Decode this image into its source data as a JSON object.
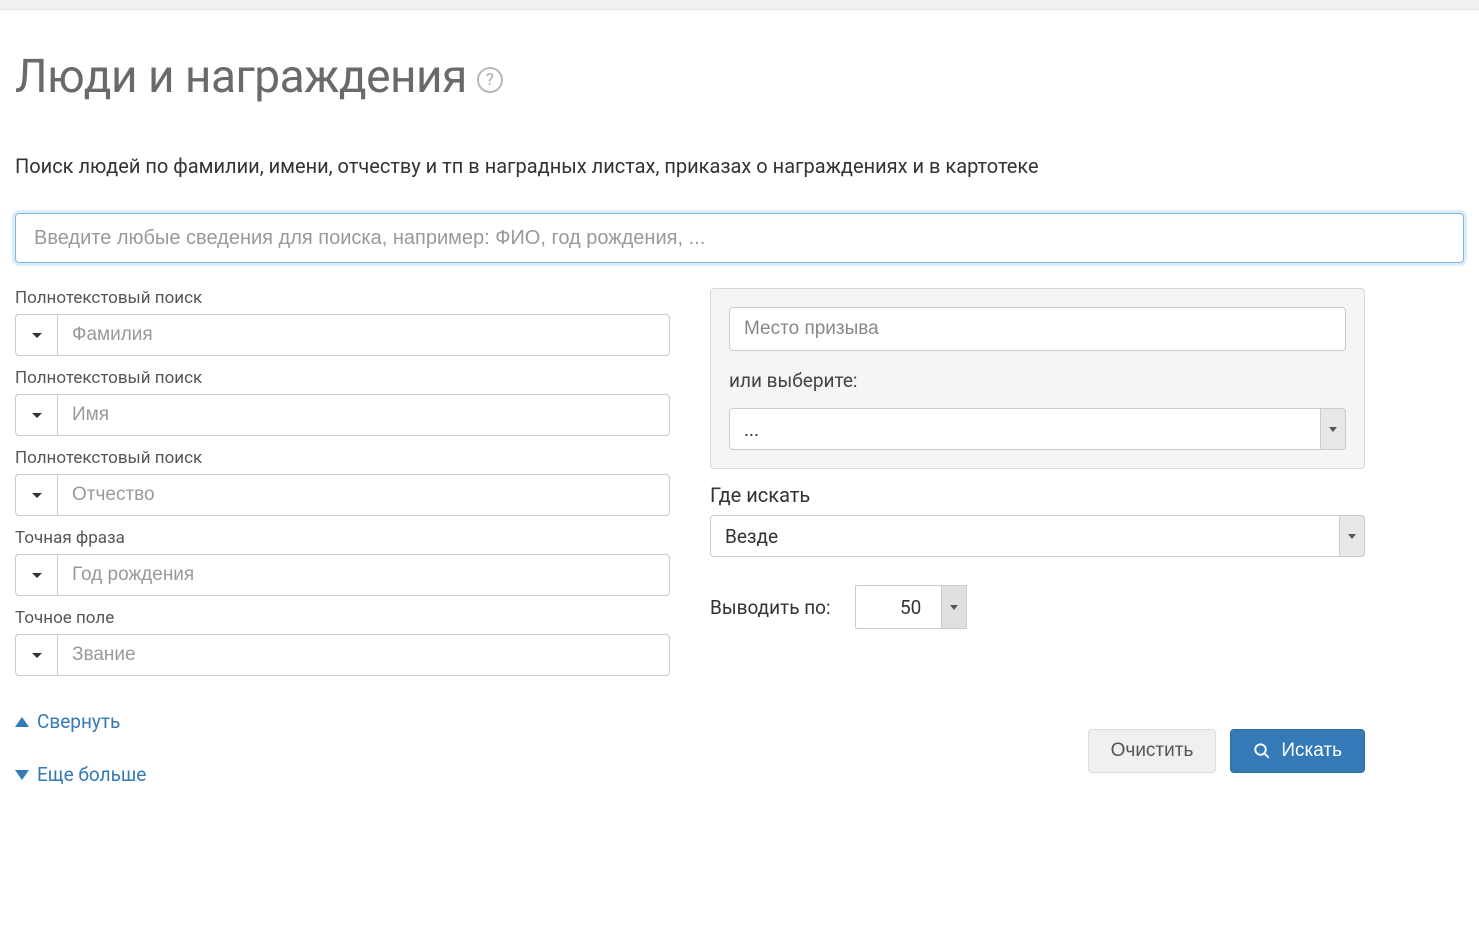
{
  "page": {
    "title": "Люди и награждения",
    "description": "Поиск людей по фамилии, имени, отчеству и тп в наградных листах, приказах о награждениях и в картотеке"
  },
  "main_search": {
    "placeholder": "Введите любые сведения для поиска, например: ФИО, год рождения, ..."
  },
  "left_fields": [
    {
      "label": "Полнотекстовый поиск",
      "placeholder": "Фамилия"
    },
    {
      "label": "Полнотекстовый поиск",
      "placeholder": "Имя"
    },
    {
      "label": "Полнотекстовый поиск",
      "placeholder": "Отчество"
    },
    {
      "label": "Точная фраза",
      "placeholder": "Год рождения"
    },
    {
      "label": "Точное поле",
      "placeholder": "Звание"
    }
  ],
  "right": {
    "place_placeholder": "Место призыва",
    "or_select": "или выберите:",
    "select_default": "...",
    "where_label": "Где искать",
    "where_value": "Везде",
    "per_page_label": "Выводить по:",
    "per_page_value": "50"
  },
  "toggles": {
    "collapse": "Свернуть",
    "more": "Еще больше"
  },
  "buttons": {
    "clear": "Очистить",
    "search": "Искать"
  }
}
